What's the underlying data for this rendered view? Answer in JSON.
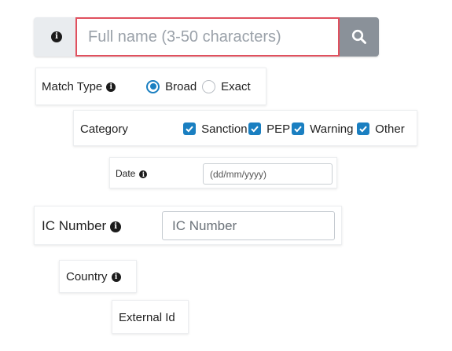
{
  "search": {
    "placeholder": "Full name (3-50 characters)",
    "info_icon": "info-icon",
    "button_icon": "search-icon"
  },
  "match_type": {
    "label": "Match Type",
    "options": [
      {
        "label": "Broad",
        "selected": true
      },
      {
        "label": "Exact",
        "selected": false
      }
    ]
  },
  "category": {
    "label": "Category",
    "options": [
      {
        "label": "Sanction",
        "checked": true
      },
      {
        "label": "PEP",
        "checked": true
      },
      {
        "label": "Warning",
        "checked": true
      },
      {
        "label": "Other",
        "checked": true
      }
    ]
  },
  "date": {
    "label": "Date",
    "placeholder": "(dd/mm/yyyy)"
  },
  "ic_number": {
    "label": "IC Number",
    "placeholder": "IC Number"
  },
  "country": {
    "label": "Country"
  },
  "external_id": {
    "label": "External Id"
  },
  "colors": {
    "accent": "#1a7fc1",
    "input_error_border": "#e0505e",
    "search_button": "#8a9199"
  }
}
